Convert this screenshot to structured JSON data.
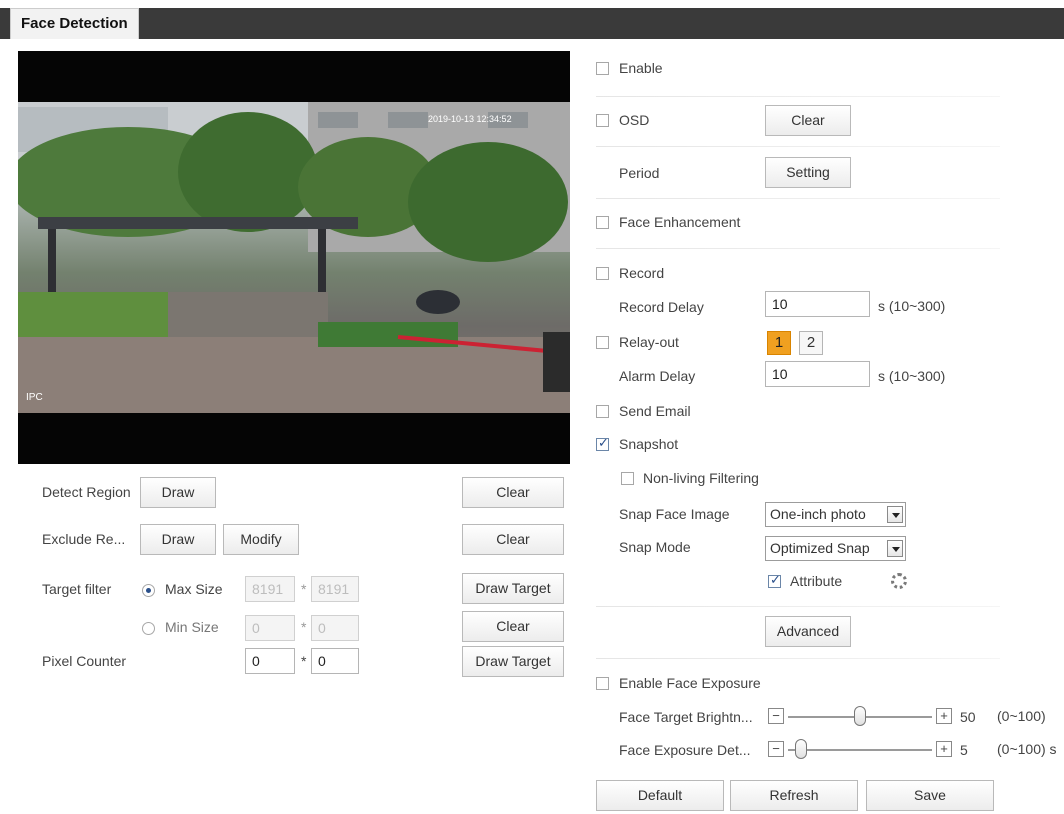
{
  "tab": {
    "title": "Face Detection"
  },
  "video": {
    "timestamp": "2019-10-13 12:34:52",
    "channel_label": "IPC"
  },
  "left_panel": {
    "detect_region": {
      "label": "Detect Region",
      "draw": "Draw",
      "clear": "Clear"
    },
    "exclude_region": {
      "label": "Exclude Re...",
      "draw": "Draw",
      "modify": "Modify",
      "clear": "Clear"
    },
    "target_filter": {
      "label": "Target filter",
      "max_label": "Max Size",
      "max_w": "8191",
      "max_h": "8191",
      "min_label": "Min Size",
      "min_w": "0",
      "min_h": "0",
      "times": "*",
      "draw_target": "Draw Target",
      "clear": "Clear"
    },
    "pixel_counter": {
      "label": "Pixel Counter",
      "w": "0",
      "h": "0",
      "times": "*",
      "draw_target": "Draw Target"
    }
  },
  "right_panel": {
    "enable": {
      "label": "Enable",
      "checked": false
    },
    "osd": {
      "label": "OSD",
      "checked": false,
      "button": "Clear"
    },
    "period": {
      "label": "Period",
      "button": "Setting"
    },
    "face_enhancement": {
      "label": "Face Enhancement",
      "checked": false
    },
    "record": {
      "label": "Record",
      "checked": false
    },
    "record_delay": {
      "label": "Record Delay",
      "value": "10",
      "range": "s (10~300)"
    },
    "relay_out": {
      "label": "Relay-out",
      "checked": false,
      "channels": [
        "1",
        "2"
      ],
      "active_channel": "1"
    },
    "alarm_delay": {
      "label": "Alarm Delay",
      "value": "10",
      "range": "s (10~300)"
    },
    "send_email": {
      "label": "Send Email",
      "checked": false
    },
    "snapshot": {
      "label": "Snapshot",
      "checked": true
    },
    "non_living": {
      "label": "Non-living Filtering",
      "checked": false
    },
    "snap_face_image": {
      "label": "Snap Face Image",
      "value": "One-inch photo"
    },
    "snap_mode": {
      "label": "Snap Mode",
      "value": "Optimized Snap"
    },
    "attribute": {
      "label": "Attribute",
      "checked": true
    },
    "advanced": {
      "button": "Advanced"
    },
    "face_exposure": {
      "label": "Enable Face Exposure",
      "checked": false
    },
    "face_target_brightness": {
      "label": "Face Target Brightn...",
      "value": "50",
      "range": "(0~100)",
      "level": 50
    },
    "face_exposure_detect": {
      "label": "Face Exposure Det...",
      "value": "5",
      "range": "(0~100) s",
      "level": 5
    },
    "minus": "−",
    "plus": "+"
  },
  "footer": {
    "default": "Default",
    "refresh": "Refresh",
    "save": "Save"
  },
  "colors": {
    "topbar": "#3a3a3a",
    "active_channel": "#f0a020",
    "check": "#2a4f8a"
  }
}
